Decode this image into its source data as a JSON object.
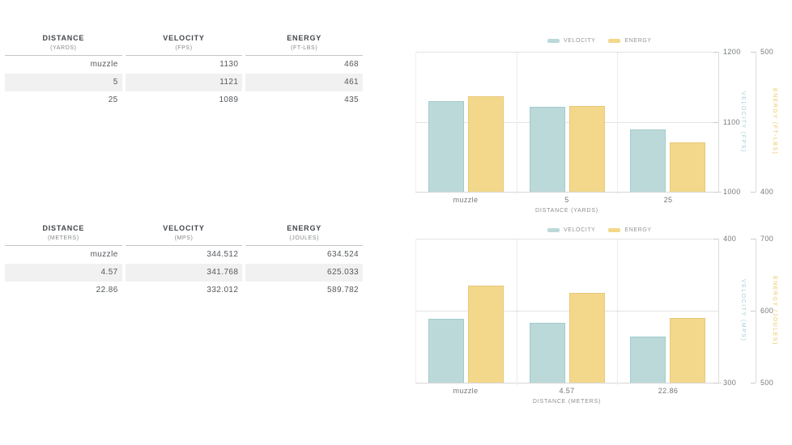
{
  "page": {
    "background": "#ffffff"
  },
  "tables": [
    {
      "name": "imperial-ballistics-table",
      "columns": [
        {
          "label": "DISTANCE",
          "unit": "(YARDS)"
        },
        {
          "label": "VELOCITY",
          "unit": "(FPS)"
        },
        {
          "label": "ENERGY",
          "unit": "(FT-LBS)"
        }
      ],
      "rows": [
        [
          "muzzle",
          "1130",
          "468"
        ],
        [
          "5",
          "1121",
          "461"
        ],
        [
          "25",
          "1089",
          "435"
        ]
      ]
    },
    {
      "name": "metric-ballistics-table",
      "columns": [
        {
          "label": "DISTANCE",
          "unit": "(METERS)"
        },
        {
          "label": "VELOCITY",
          "unit": "(MPS)"
        },
        {
          "label": "ENERGY",
          "unit": "(JOULES)"
        }
      ],
      "rows": [
        [
          "muzzle",
          "344.512",
          "634.524"
        ],
        [
          "4.57",
          "341.768",
          "625.033"
        ],
        [
          "22.86",
          "332.012",
          "589.782"
        ]
      ]
    }
  ],
  "chart_data": [
    {
      "type": "bar",
      "title": "",
      "categories": [
        "muzzle",
        "5",
        "25"
      ],
      "xlabel": "DISTANCE (YARDS)",
      "legend_position": "top",
      "grid": "horizontal-on vertical-dotted",
      "series": [
        {
          "name": "VELOCITY",
          "axis_label": "VELOCITY (FPS)",
          "values": [
            1130,
            1121,
            1089
          ],
          "ylim": [
            1000,
            1200
          ],
          "ticks": [
            1200,
            1100,
            1000
          ],
          "color": "#bcd9d9",
          "border_color": "#a3cbcd",
          "label_color": "#a4cfd3"
        },
        {
          "name": "ENERGY",
          "axis_label": "ENERGY (FT-LBS)",
          "values": [
            468,
            461,
            435
          ],
          "ylim": [
            400,
            500
          ],
          "ticks": [
            500,
            400
          ],
          "color": "#f3d88b",
          "border_color": "#e7c878",
          "label_color": "#edc765"
        }
      ]
    },
    {
      "type": "bar",
      "title": "",
      "categories": [
        "muzzle",
        "4.57",
        "22.86"
      ],
      "xlabel": "DISTANCE (METERS)",
      "legend_position": "top",
      "grid": "horizontal-on vertical-dotted",
      "series": [
        {
          "name": "VELOCITY",
          "axis_label": "VELOCITY (MPS)",
          "values": [
            344.512,
            341.768,
            332.012
          ],
          "ylim": [
            300,
            400
          ],
          "ticks": [
            400,
            300
          ],
          "color": "#bcd9d9",
          "border_color": "#a3cbcd",
          "label_color": "#a4cfd3"
        },
        {
          "name": "ENERGY",
          "axis_label": "ENERGY (JOULES)",
          "values": [
            634.524,
            625.033,
            589.782
          ],
          "ylim": [
            500,
            700
          ],
          "ticks": [
            700,
            600,
            500
          ],
          "color": "#f3d88b",
          "border_color": "#e7c878",
          "label_color": "#edc765"
        }
      ]
    }
  ],
  "colors": {
    "velocity": "#bcd9d9",
    "energy": "#f3d88b",
    "grid_line": "#e3e3e3",
    "axis_line": "#d7d7d7",
    "tick_text": "#75797d",
    "legend_text": "#92969a",
    "table_header_text": "#42464a",
    "table_unit_text": "#85898d",
    "table_cell_text": "#54585c",
    "table_stripe": "#f1f1f1"
  }
}
